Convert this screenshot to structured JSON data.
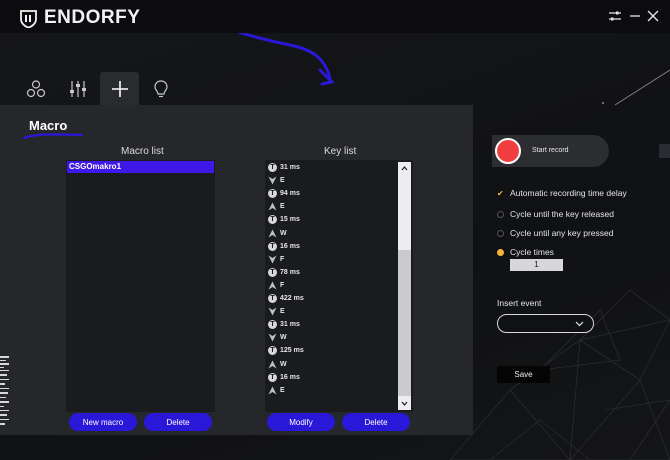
{
  "brand": {
    "name": "ENDORFY"
  },
  "titlebar": {
    "settings_icon": "sliders-icon",
    "minimize_icon": "minimize-icon",
    "close_icon": "close-icon"
  },
  "tabs": [
    {
      "icon": "circles-icon"
    },
    {
      "icon": "equalizer-icon"
    },
    {
      "icon": "plus-icon",
      "active": true
    },
    {
      "icon": "lightbulb-icon"
    }
  ],
  "panel": {
    "title": "Macro"
  },
  "macro_list": {
    "title": "Macro list",
    "items": [
      "CSGOmakro1"
    ],
    "new_label": "New macro",
    "delete_label": "Delete"
  },
  "key_list": {
    "title": "Key list",
    "items": [
      {
        "kind": "time",
        "text": "31 ms"
      },
      {
        "kind": "down",
        "text": "E"
      },
      {
        "kind": "time",
        "text": "94 ms"
      },
      {
        "kind": "up",
        "text": "E"
      },
      {
        "kind": "time",
        "text": "15 ms"
      },
      {
        "kind": "up",
        "text": "W"
      },
      {
        "kind": "time",
        "text": "16 ms"
      },
      {
        "kind": "down",
        "text": "F"
      },
      {
        "kind": "time",
        "text": "78 ms"
      },
      {
        "kind": "up",
        "text": "F"
      },
      {
        "kind": "time",
        "text": "422 ms"
      },
      {
        "kind": "down",
        "text": "E"
      },
      {
        "kind": "time",
        "text": "31 ms"
      },
      {
        "kind": "down",
        "text": "W"
      },
      {
        "kind": "time",
        "text": "125 ms"
      },
      {
        "kind": "up",
        "text": "W"
      },
      {
        "kind": "time",
        "text": "16 ms"
      },
      {
        "kind": "up",
        "text": "E"
      }
    ],
    "modify_label": "Modify",
    "delete_label": "Delete"
  },
  "record": {
    "label": "Start record"
  },
  "options": {
    "auto_delay": {
      "label": "Automatic recording time delay",
      "checked": true
    },
    "cycle_released": {
      "label": "Cycle until the key released",
      "selected": false
    },
    "cycle_any_key": {
      "label": "Cycle until any key pressed",
      "selected": false
    },
    "cycle_times": {
      "label": "Cycle times",
      "selected": true,
      "value": "1"
    }
  },
  "insert_event": {
    "label": "Insert event",
    "value": ""
  },
  "save": {
    "label": "Save"
  },
  "colors": {
    "accent": "#2a18d8",
    "selection": "#3d18e8",
    "record": "#f03e3e",
    "option_active": "#f4b73a"
  }
}
